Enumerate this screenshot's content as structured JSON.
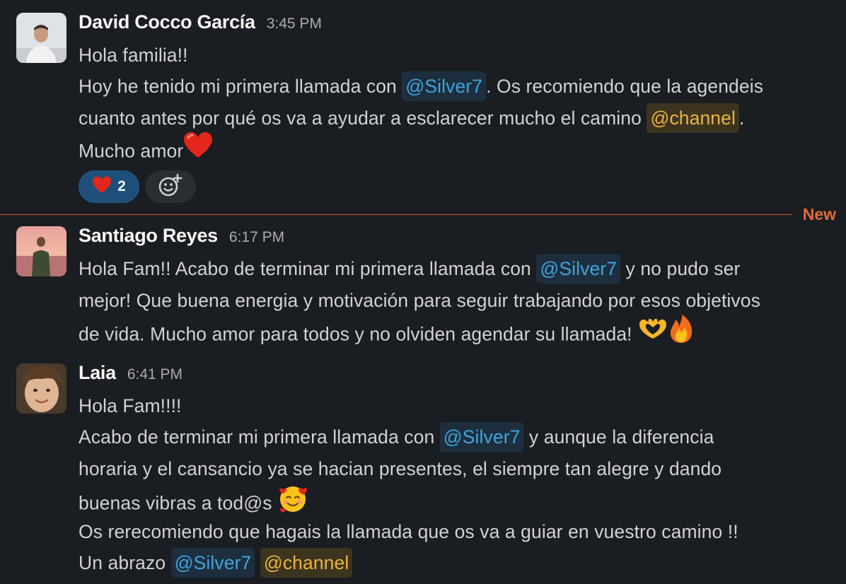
{
  "colors": {
    "background": "#1a1d21",
    "text": "#d1d2d3",
    "author": "#f8f8f8",
    "timestamp": "#ababad",
    "user_mention": "#3fa3de",
    "channel_mention": "#eab33c",
    "new_divider": "#e26a3a"
  },
  "messages": [
    {
      "author": "David Cocco García",
      "time": "3:45 PM",
      "avatar_icon": "user-avatar-photo",
      "lines": {
        "l1": "Hola familia!!",
        "l2a": "Hoy he tenido mi primera llamada con ",
        "l2m": "@Silver7",
        "l2b": ". Os recomiendo que la agendeis",
        "l3a": "cuanto antes por qué os va a ayudar a esclarecer mucho el camino ",
        "l3m": "@channel",
        "l3b": ".",
        "l4a": "Mucho amor"
      },
      "emojis": [
        "red-heart"
      ],
      "reactions": [
        {
          "emoji": "red-heart",
          "count": "2",
          "active": true
        }
      ],
      "add_reaction_icon": "add-reaction-icon"
    },
    {
      "author": "Santiago Reyes",
      "time": "6:17 PM",
      "avatar_icon": "user-avatar-photo",
      "lines": {
        "l1a": "Hola Fam!! Acabo de terminar mi primera llamada con ",
        "l1m": "@Silver7",
        "l1b": " y no pudo ser",
        "l2": "mejor! Que buena energia y motivación para seguir trabajando por esos objetivos",
        "l3": "de vida. Mucho amor para todos y no olviden agendar su llamada! "
      },
      "emojis": [
        "heart-hands",
        "fire"
      ]
    },
    {
      "author": "Laia",
      "time": "6:41 PM",
      "avatar_icon": "user-avatar-photo",
      "lines": {
        "l1": "Hola Fam!!!!",
        "l2a": "Acabo de terminar mi primera llamada con ",
        "l2m": "@Silver7",
        "l2b": " y aunque la diferencia",
        "l3": "horaria y el cansancio ya se hacian presentes, el siempre tan alegre y dando",
        "l4": "buenas vibras a tod@s ",
        "l5": "Os rerecomiendo que hagais la llamada que os va a guiar en vuestro camino !!",
        "l6a": "Un abrazo ",
        "l6m1": "@Silver7",
        "l6m2": "@channel"
      },
      "emojis": [
        "smiling-face-with-hearts"
      ]
    }
  ],
  "divider": {
    "label": "New"
  }
}
